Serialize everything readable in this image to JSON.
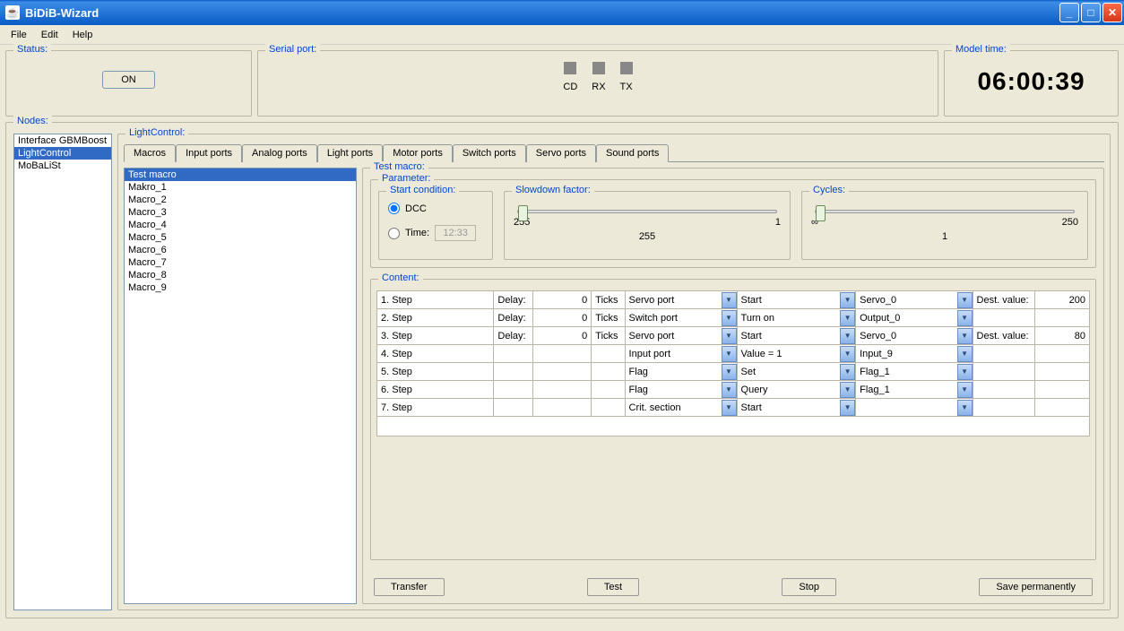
{
  "window": {
    "title": "BiDiB-Wizard"
  },
  "menu": {
    "file": "File",
    "edit": "Edit",
    "help": "Help"
  },
  "status": {
    "legend": "Status:",
    "on_label": "ON"
  },
  "serial": {
    "legend": "Serial port:",
    "cd": "CD",
    "rx": "RX",
    "tx": "TX"
  },
  "model": {
    "legend": "Model time:",
    "time": "06:00:39"
  },
  "nodes": {
    "legend": "Nodes:",
    "items": [
      "Interface GBMBoost",
      "LightControl",
      "MoBaLiSt"
    ],
    "selected": 1
  },
  "lightcontrol": {
    "legend": "LightControl:",
    "tabs": [
      "Macros",
      "Input ports",
      "Analog ports",
      "Light ports",
      "Motor ports",
      "Switch ports",
      "Servo ports",
      "Sound ports"
    ],
    "active_tab": 0,
    "macros": [
      "Test macro",
      "Makro_1",
      "Macro_2",
      "Macro_3",
      "Macro_4",
      "Macro_5",
      "Macro_6",
      "Macro_7",
      "Macro_8",
      "Macro_9"
    ],
    "selected_macro": 0,
    "detail_legend": "Test macro:",
    "parameter_legend": "Parameter:",
    "start_legend": "Start condition:",
    "start_dcc": "DCC",
    "start_time": "Time:",
    "time_value": "12:33",
    "slowdown_legend": "Slowdown factor:",
    "slowdown_min": "255",
    "slowdown_max": "1",
    "slowdown_center": "255",
    "cycles_legend": "Cycles:",
    "cycles_min": "∞",
    "cycles_max": "250",
    "cycles_center": "1",
    "content_legend": "Content:",
    "content_labels": {
      "delay": "Delay:",
      "ticks": "Ticks",
      "dest_value": "Dest. value:"
    },
    "content_rows": [
      {
        "step": "1. Step",
        "delay": "0",
        "ticks": true,
        "port": "Servo port",
        "action": "Start",
        "target": "Servo_0",
        "dest": "200"
      },
      {
        "step": "2. Step",
        "delay": "0",
        "ticks": true,
        "port": "Switch port",
        "action": "Turn on",
        "target": "Output_0",
        "dest": null
      },
      {
        "step": "3. Step",
        "delay": "0",
        "ticks": true,
        "port": "Servo port",
        "action": "Start",
        "target": "Servo_0",
        "dest": "80"
      },
      {
        "step": "4. Step",
        "delay": null,
        "ticks": false,
        "port": "Input port",
        "action": "Value = 1",
        "target": "Input_9",
        "dest": null
      },
      {
        "step": "5. Step",
        "delay": null,
        "ticks": false,
        "port": "Flag",
        "action": "Set",
        "target": "Flag_1",
        "dest": null
      },
      {
        "step": "6. Step",
        "delay": null,
        "ticks": false,
        "port": "Flag",
        "action": "Query",
        "target": "Flag_1",
        "dest": null
      },
      {
        "step": "7. Step",
        "delay": null,
        "ticks": false,
        "port": "Crit. section",
        "action": "Start",
        "target": "",
        "dest": null
      }
    ],
    "buttons": {
      "transfer": "Transfer",
      "test": "Test",
      "stop": "Stop",
      "save": "Save permanently"
    }
  }
}
